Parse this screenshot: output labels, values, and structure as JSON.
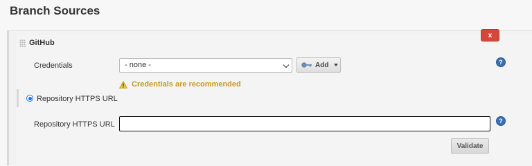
{
  "section": {
    "title": "Branch Sources"
  },
  "source_panel": {
    "title": "GitHub",
    "delete_label": "x",
    "credentials": {
      "label": "Credentials",
      "selected": "- none -",
      "add_label": "Add",
      "warning": "Credentials are recommended",
      "help_label": "?"
    },
    "repository": {
      "radio_label": "Repository HTTPS URL",
      "field_label": "Repository HTTPS URL",
      "value": "",
      "help_label": "?",
      "validate_label": "Validate"
    }
  },
  "colors": {
    "delete_red": "#d24939",
    "warning_text": "#c49a1a",
    "help_blue": "#3a6fb5",
    "radio_blue": "#1a73e8"
  },
  "icons": {
    "key": "key-icon",
    "warning": "warning-triangle-icon",
    "help": "help-icon",
    "drag": "drag-handle-icon"
  }
}
